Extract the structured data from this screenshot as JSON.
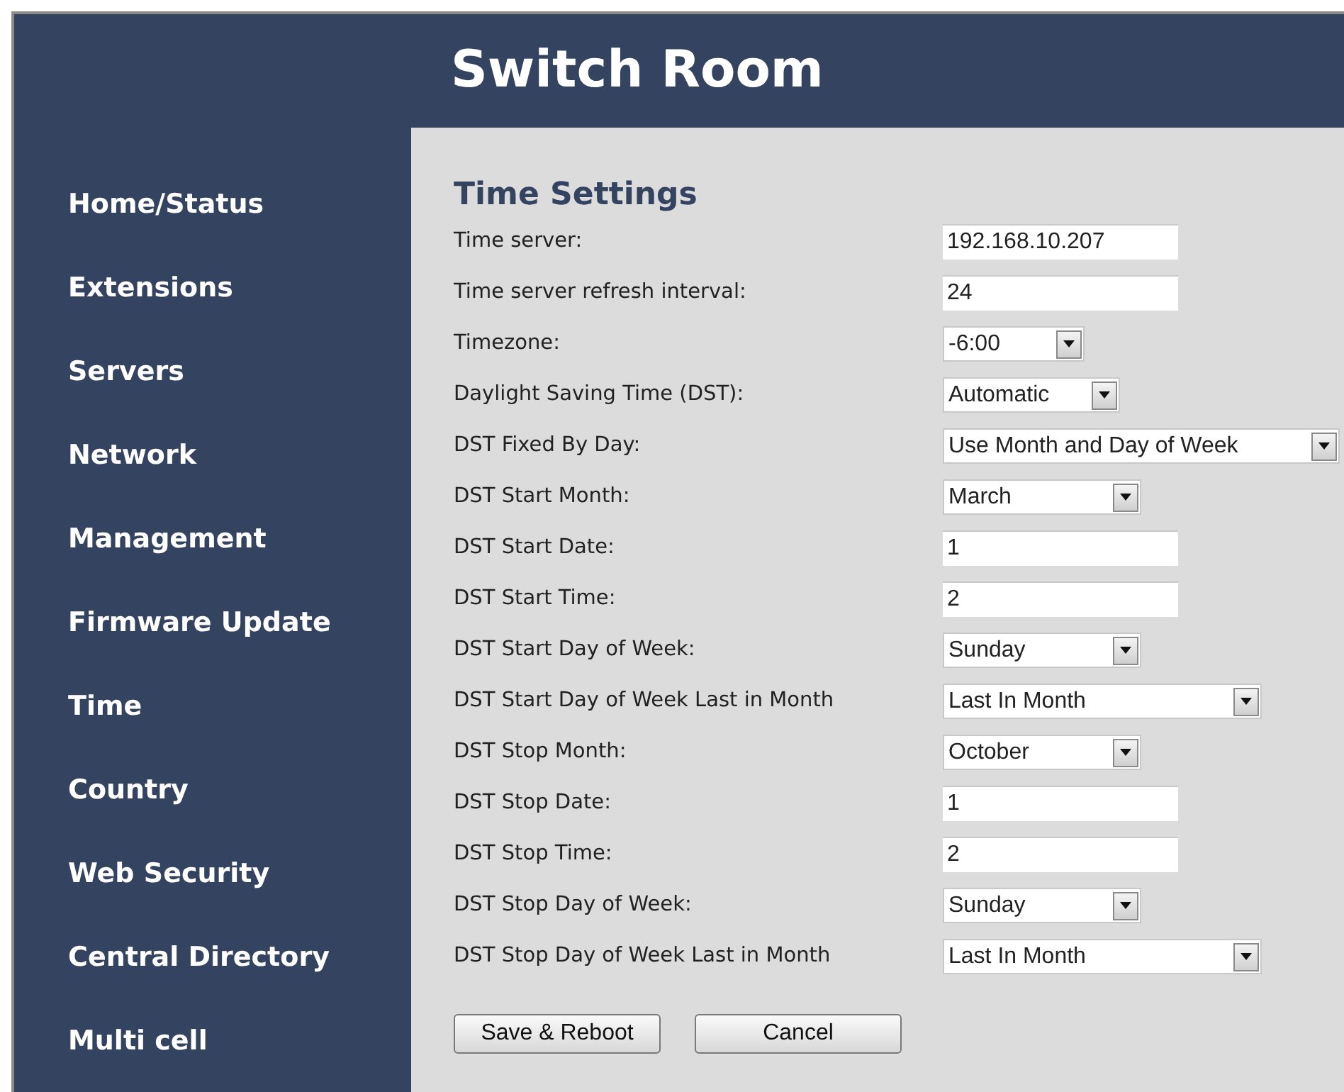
{
  "header": {
    "title": "Switch Room"
  },
  "sidebar": {
    "items": [
      {
        "label": "Home/Status"
      },
      {
        "label": "Extensions"
      },
      {
        "label": "Servers"
      },
      {
        "label": "Network"
      },
      {
        "label": "Management"
      },
      {
        "label": "Firmware Update"
      },
      {
        "label": "Time"
      },
      {
        "label": "Country"
      },
      {
        "label": "Web Security"
      },
      {
        "label": "Central Directory"
      },
      {
        "label": "Multi cell"
      }
    ]
  },
  "form": {
    "title": "Time Settings",
    "rows": [
      {
        "label": "Time server:",
        "kind": "text",
        "value": "192.168.10.207"
      },
      {
        "label": "Time server refresh interval:",
        "kind": "text",
        "value": "24"
      },
      {
        "label": "Timezone:",
        "kind": "select",
        "value": "-6:00"
      },
      {
        "label": "Daylight Saving Time (DST):",
        "kind": "select",
        "value": "Automatic"
      },
      {
        "label": "DST Fixed By Day:",
        "kind": "select",
        "value": "Use Month and Day of Week"
      },
      {
        "label": "DST Start Month:",
        "kind": "select",
        "value": "March"
      },
      {
        "label": "DST Start Date:",
        "kind": "text",
        "value": "1"
      },
      {
        "label": "DST Start Time:",
        "kind": "text",
        "value": "2"
      },
      {
        "label": "DST Start Day of Week:",
        "kind": "select",
        "value": "Sunday"
      },
      {
        "label": "DST Start Day of Week Last in Month",
        "kind": "select",
        "value": "Last In Month"
      },
      {
        "label": "DST Stop Month:",
        "kind": "select",
        "value": "October"
      },
      {
        "label": "DST Stop Date:",
        "kind": "text",
        "value": "1"
      },
      {
        "label": "DST Stop Time:",
        "kind": "text",
        "value": "2"
      },
      {
        "label": "DST Stop Day of Week:",
        "kind": "select",
        "value": "Sunday"
      },
      {
        "label": "DST Stop Day of Week Last in Month",
        "kind": "select",
        "value": "Last In Month"
      }
    ],
    "buttons": [
      "Save & Reboot",
      "Cancel"
    ]
  }
}
